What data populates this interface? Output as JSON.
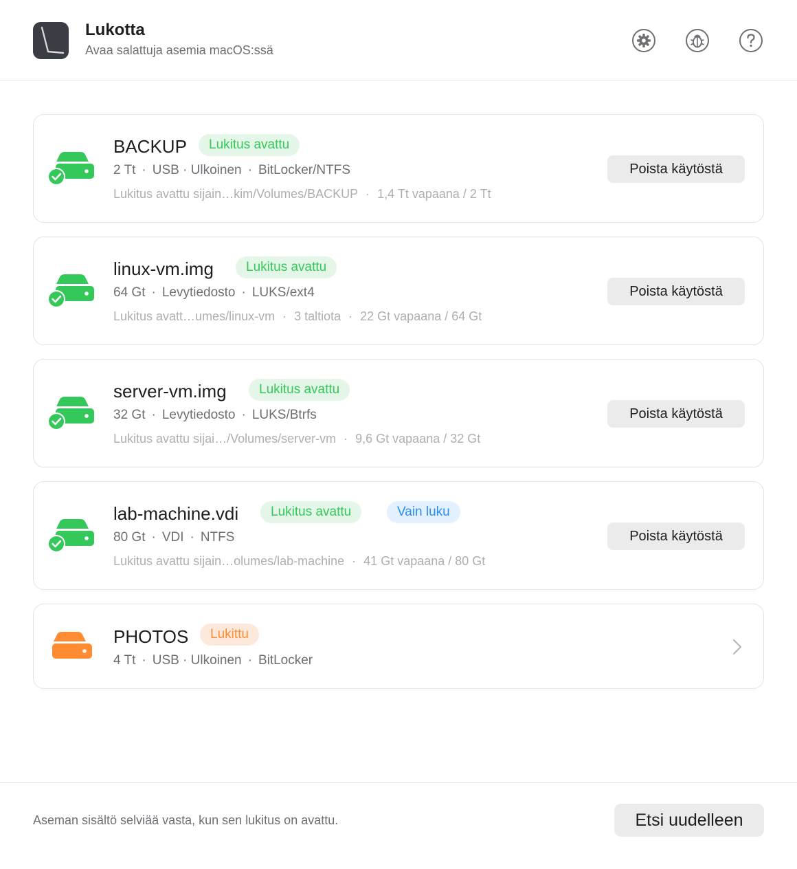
{
  "header": {
    "title": "Lukotta",
    "subtitle": "Avaa salattuja asemia macOS:ssä",
    "icons": [
      "gear-icon",
      "bug-icon",
      "help-icon"
    ]
  },
  "colors": {
    "unlocked": "#34c759",
    "locked": "#ff8c32",
    "readonly": "#2a8cf5"
  },
  "volumes": [
    {
      "name": "BACKUP",
      "status": "Lukitus avattu",
      "meta": [
        "2 Tt",
        "USB · Ulkoinen",
        "BitLocker/NTFS"
      ],
      "path": [
        "Lukitus avattu sijain…kim/Volumes/BACKUP",
        "1,4 Tt vapaana / 2 Tt"
      ],
      "action": "Poista käytöstä"
    },
    {
      "name": "linux-vm.img",
      "status": "Lukitus avattu",
      "meta": [
        "64 Gt",
        "Levytiedosto",
        "LUKS/ext4"
      ],
      "path": [
        "Lukitus avatt…umes/linux-vm",
        "3 taltiota",
        "22 Gt vapaana / 64 Gt"
      ],
      "action": "Poista käytöstä"
    },
    {
      "name": "server-vm.img",
      "status": "Lukitus avattu",
      "meta": [
        "32 Gt",
        "Levytiedosto",
        "LUKS/Btrfs"
      ],
      "path": [
        "Lukitus avattu sijai…/Volumes/server-vm",
        "9,6 Gt vapaana / 32 Gt"
      ],
      "action": "Poista käytöstä"
    },
    {
      "name": "lab-machine.vdi",
      "status": "Lukitus avattu",
      "extra_badge": "Vain luku",
      "meta": [
        "80 Gt",
        "VDI",
        "NTFS"
      ],
      "path": [
        "Lukitus avattu sijain…olumes/lab-machine",
        "41 Gt vapaana / 80 Gt"
      ],
      "action": "Poista käytöstä"
    },
    {
      "name": "PHOTOS",
      "status": "Lukittu",
      "meta": [
        "4 Tt",
        "USB · Ulkoinen",
        "BitLocker"
      ]
    }
  ],
  "footer": {
    "note": "Aseman sisältö selviää vasta, kun sen lukitus on avattu.",
    "rescan_label": "Etsi uudelleen"
  }
}
